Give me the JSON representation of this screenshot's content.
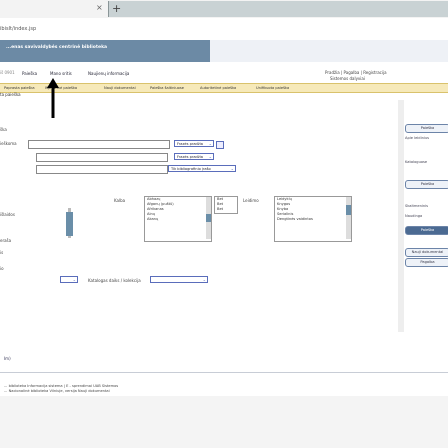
{
  "browser": {
    "close_glyph": "×",
    "new_tab_glyph": "+",
    "url": "ibisIt/index.jsp"
  },
  "header": {
    "title": "...enas savivaldybės centrinė biblioteka"
  },
  "top_links": "Pradžia | Pagalba | Registracija",
  "top_search": "Sistemos dalyviai",
  "stat_label": "iš 0901",
  "menu1": [
    "Paieška",
    "Mano sritis",
    "Naujienų informacija"
  ],
  "menu2": [
    "Paprasta paieška",
    "Išplėstinė paieška",
    "Nauji dokumentai",
    "Paieška šaltiniuose",
    "Autoritetinė paieška",
    "Unifikuota paieška"
  ],
  "sub_label": "ta paieška",
  "form": {
    "label_a": "ška",
    "label_b": "ieškoma",
    "select1": "Frazės pradžia",
    "select2": "Frazės pradžia",
    "select3": "Tik bibliografinio įrašo"
  },
  "filters": {
    "label_a": "išlaidos",
    "label_b": "eraša",
    "label_c": "is",
    "label_d": "io",
    "col2_label": "Kalba",
    "col3_label": "Leidimo",
    "catalog_label": "Katalogas daiks / kolekcija",
    "box1": [
      "Abhazų",
      "Afganų (puštū)",
      "Afrikanas",
      "Ainų",
      "Akanų"
    ],
    "box2": [
      "Bet",
      "Bet",
      "Bet"
    ],
    "box3": [
      "Leidyklų",
      "Knygos",
      "Knyba",
      "Serialinis",
      "Dengtinės vaidintos"
    ]
  },
  "right_col": {
    "tag1": "Paieška",
    "text1": "Apie leidinius",
    "text2": "Kataloguose",
    "tag2": "Paieška",
    "text3": "Skaitmeninis",
    "text4": "Naudinga",
    "btn_dark": "Paieška",
    "btn1": "Nauji dokumentai",
    "btn2": "Pagalba"
  },
  "small_link": "Im)",
  "footer": {
    "line1": "... biblioteka Informacija sistema | E - sprendimai UAB Sistemos",
    "line2": "... Nacionalinė biblioteka Vilniuje, versija Nauji dokumentai"
  },
  "colors": {
    "banner": "#6c8aa5",
    "menu2": "#f6e9b9",
    "accent": "#5a6dbb"
  }
}
